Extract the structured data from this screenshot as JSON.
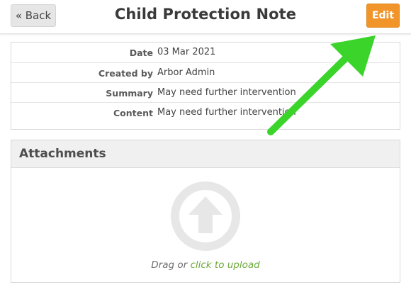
{
  "header": {
    "back_label": "« Back",
    "title": "Child Protection Note",
    "edit_label": "Edit"
  },
  "details": [
    {
      "label": "Date",
      "value": "03 Mar 2021"
    },
    {
      "label": "Created by",
      "value": "Arbor Admin"
    },
    {
      "label": "Summary",
      "value": "May need further intervention"
    },
    {
      "label": "Content",
      "value": "May need further intervention"
    }
  ],
  "attachments": {
    "title": "Attachments",
    "drag_text": "Drag or",
    "upload_link": "click to upload"
  },
  "colors": {
    "edit_button": "#f1952b",
    "upload_link": "#6ca83a",
    "annotation_arrow": "#3bd42b"
  },
  "icons": {
    "upload": "upload-arrow-circle-icon",
    "annotation": "green-arrow-pointer"
  }
}
